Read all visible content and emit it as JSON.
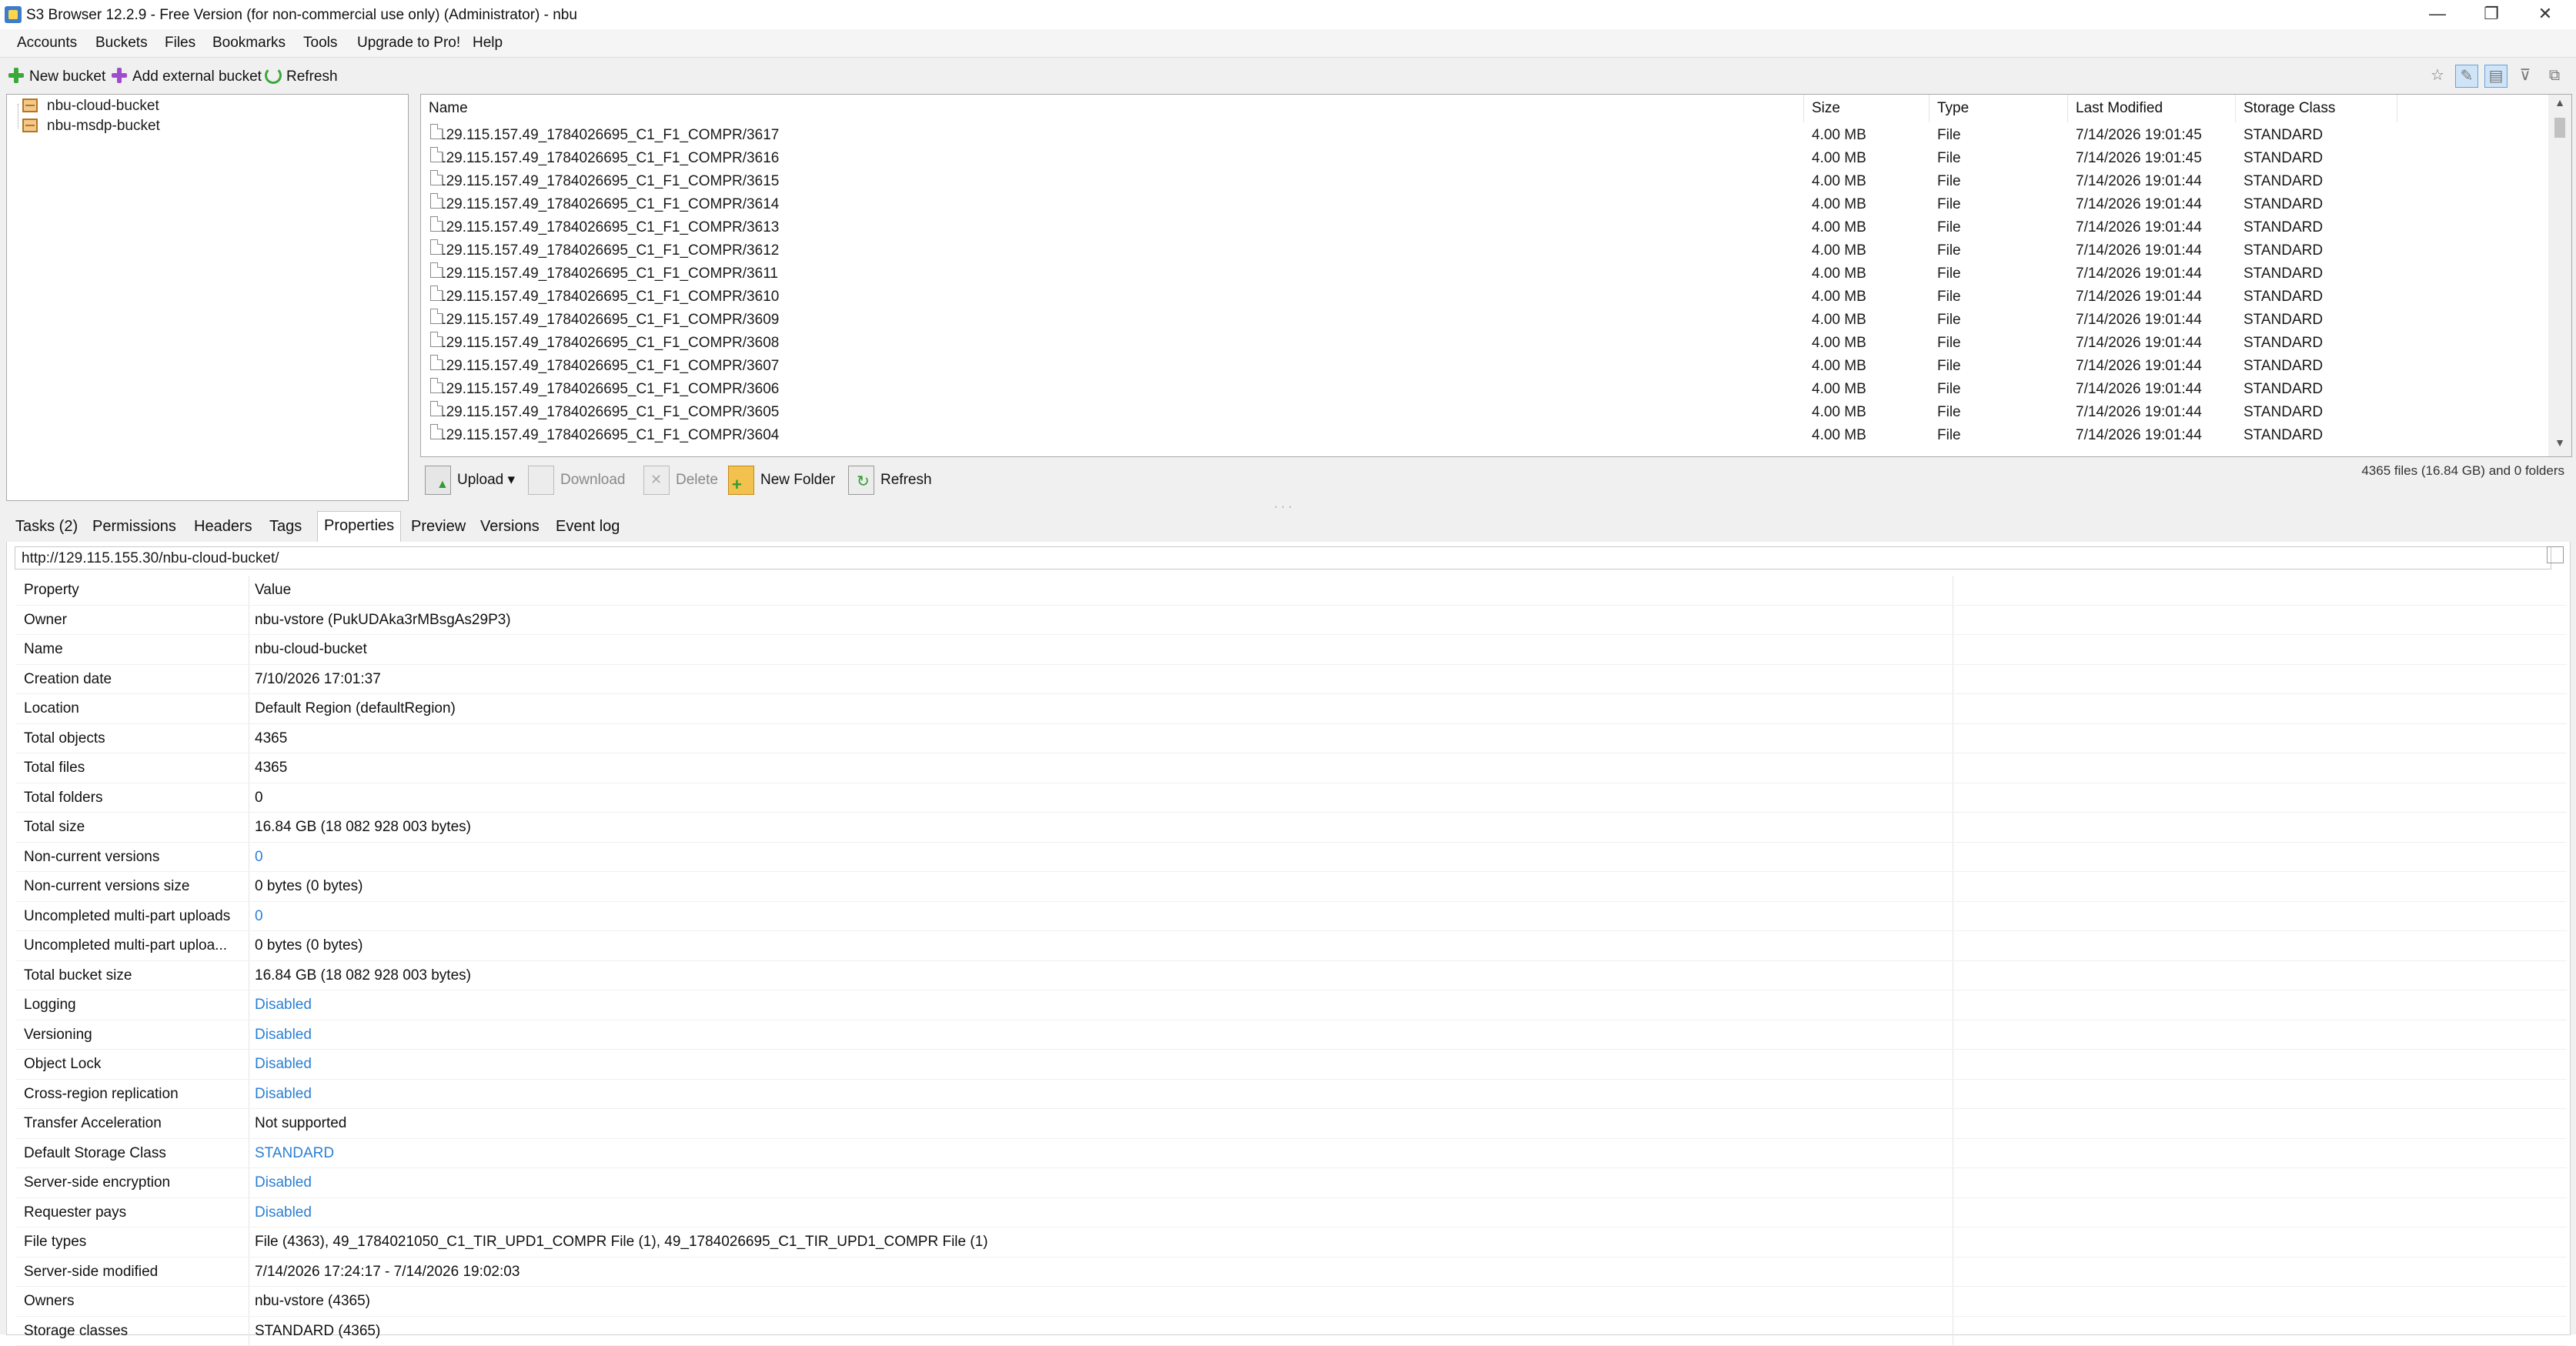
{
  "window": {
    "title": "S3 Browser 12.2.9 - Free Version (for non-commercial use only) (Administrator) - nbu",
    "controls": {
      "minimize": "—",
      "maximize": "❐",
      "close": "✕"
    }
  },
  "menu": [
    "Accounts",
    "Buckets",
    "Files",
    "Bookmarks",
    "Tools",
    "Upgrade to Pro!",
    "Help"
  ],
  "left_toolbar": {
    "new_bucket": "New bucket",
    "add_external": "Add external bucket",
    "refresh": "Refresh"
  },
  "buckets": [
    "nbu-cloud-bucket",
    "nbu-msdp-bucket"
  ],
  "file_list": {
    "columns": [
      "Name",
      "Size",
      "Type",
      "Last Modified",
      "Storage Class"
    ],
    "rows": [
      [
        "129.115.157.49_1784026695_C1_F1_COMPR/3617",
        "4.00 MB",
        "File",
        "7/14/2026 19:01:45",
        "STANDARD"
      ],
      [
        "129.115.157.49_1784026695_C1_F1_COMPR/3616",
        "4.00 MB",
        "File",
        "7/14/2026 19:01:45",
        "STANDARD"
      ],
      [
        "129.115.157.49_1784026695_C1_F1_COMPR/3615",
        "4.00 MB",
        "File",
        "7/14/2026 19:01:44",
        "STANDARD"
      ],
      [
        "129.115.157.49_1784026695_C1_F1_COMPR/3614",
        "4.00 MB",
        "File",
        "7/14/2026 19:01:44",
        "STANDARD"
      ],
      [
        "129.115.157.49_1784026695_C1_F1_COMPR/3613",
        "4.00 MB",
        "File",
        "7/14/2026 19:01:44",
        "STANDARD"
      ],
      [
        "129.115.157.49_1784026695_C1_F1_COMPR/3612",
        "4.00 MB",
        "File",
        "7/14/2026 19:01:44",
        "STANDARD"
      ],
      [
        "129.115.157.49_1784026695_C1_F1_COMPR/3611",
        "4.00 MB",
        "File",
        "7/14/2026 19:01:44",
        "STANDARD"
      ],
      [
        "129.115.157.49_1784026695_C1_F1_COMPR/3610",
        "4.00 MB",
        "File",
        "7/14/2026 19:01:44",
        "STANDARD"
      ],
      [
        "129.115.157.49_1784026695_C1_F1_COMPR/3609",
        "4.00 MB",
        "File",
        "7/14/2026 19:01:44",
        "STANDARD"
      ],
      [
        "129.115.157.49_1784026695_C1_F1_COMPR/3608",
        "4.00 MB",
        "File",
        "7/14/2026 19:01:44",
        "STANDARD"
      ],
      [
        "129.115.157.49_1784026695_C1_F1_COMPR/3607",
        "4.00 MB",
        "File",
        "7/14/2026 19:01:44",
        "STANDARD"
      ],
      [
        "129.115.157.49_1784026695_C1_F1_COMPR/3606",
        "4.00 MB",
        "File",
        "7/14/2026 19:01:44",
        "STANDARD"
      ],
      [
        "129.115.157.49_1784026695_C1_F1_COMPR/3605",
        "4.00 MB",
        "File",
        "7/14/2026 19:01:44",
        "STANDARD"
      ],
      [
        "129.115.157.49_1784026695_C1_F1_COMPR/3604",
        "4.00 MB",
        "File",
        "7/14/2026 19:01:44",
        "STANDARD"
      ]
    ]
  },
  "file_actions": {
    "upload": "Upload",
    "download": "Download",
    "delete": "Delete",
    "new_folder": "New Folder",
    "refresh": "Refresh"
  },
  "file_count": "4365 files (16.84 GB) and 0 folders",
  "tabs": [
    "Tasks (2)",
    "Permissions",
    "Headers",
    "Tags",
    "Properties",
    "Preview",
    "Versions",
    "Event log"
  ],
  "active_tab": "Properties",
  "properties": {
    "url": "http://129.115.155.30/nbu-cloud-bucket/",
    "header": {
      "key": "Property",
      "value": "Value"
    },
    "rows": [
      {
        "key": "Owner",
        "value": "nbu-vstore (PukUDAka3rMBsgAs29P3)"
      },
      {
        "key": "Name",
        "value": "nbu-cloud-bucket"
      },
      {
        "key": "Creation date",
        "value": "7/10/2026 17:01:37"
      },
      {
        "key": "Location",
        "value": "Default Region (defaultRegion)"
      },
      {
        "key": "Total objects",
        "value": "4365"
      },
      {
        "key": "Total files",
        "value": "4365"
      },
      {
        "key": "Total folders",
        "value": "0"
      },
      {
        "key": "Total size",
        "value": "16.84 GB (18 082 928 003 bytes)"
      },
      {
        "key": "Non-current versions",
        "value": "0",
        "link": true
      },
      {
        "key": "Non-current versions size",
        "value": "0 bytes (0 bytes)"
      },
      {
        "key": "Uncompleted multi-part uploads",
        "value": "0",
        "link": true
      },
      {
        "key": "Uncompleted multi-part uploa...",
        "value": "0 bytes (0 bytes)"
      },
      {
        "key": "Total bucket size",
        "value": "16.84 GB (18 082 928 003 bytes)"
      },
      {
        "key": "Logging",
        "value": "Disabled",
        "link": true
      },
      {
        "key": "Versioning",
        "value": "Disabled",
        "link": true
      },
      {
        "key": "Object Lock",
        "value": "Disabled",
        "link": true
      },
      {
        "key": "Cross-region replication",
        "value": "Disabled",
        "link": true
      },
      {
        "key": "Transfer Acceleration",
        "value": "Not supported"
      },
      {
        "key": "Default Storage Class",
        "value": "STANDARD",
        "link": true
      },
      {
        "key": "Server-side encryption",
        "value": "Disabled",
        "link": true
      },
      {
        "key": "Requester pays",
        "value": "Disabled",
        "link": true
      },
      {
        "key": "File types",
        "value": "File (4363), 49_1784021050_C1_TIR_UPD1_COMPR File (1), 49_1784026695_C1_TIR_UPD1_COMPR File (1)"
      },
      {
        "key": "Server-side modified",
        "value": "7/14/2026 17:24:17 - 7/14/2026 19:02:03"
      },
      {
        "key": "Owners",
        "value": "nbu-vstore (4365)"
      },
      {
        "key": "Storage classes",
        "value": "STANDARD (4365)"
      }
    ]
  },
  "colors": {
    "link": "#2a7fd4",
    "selection": "#cfe4f7"
  },
  "icons": [
    "app-icon",
    "new-bucket-icon",
    "add-external-bucket-icon",
    "refresh-icon",
    "bucket-icon",
    "file-icon",
    "bookmark-icon",
    "edit-icon",
    "view-icon",
    "filter-icon",
    "copy-icon"
  ]
}
